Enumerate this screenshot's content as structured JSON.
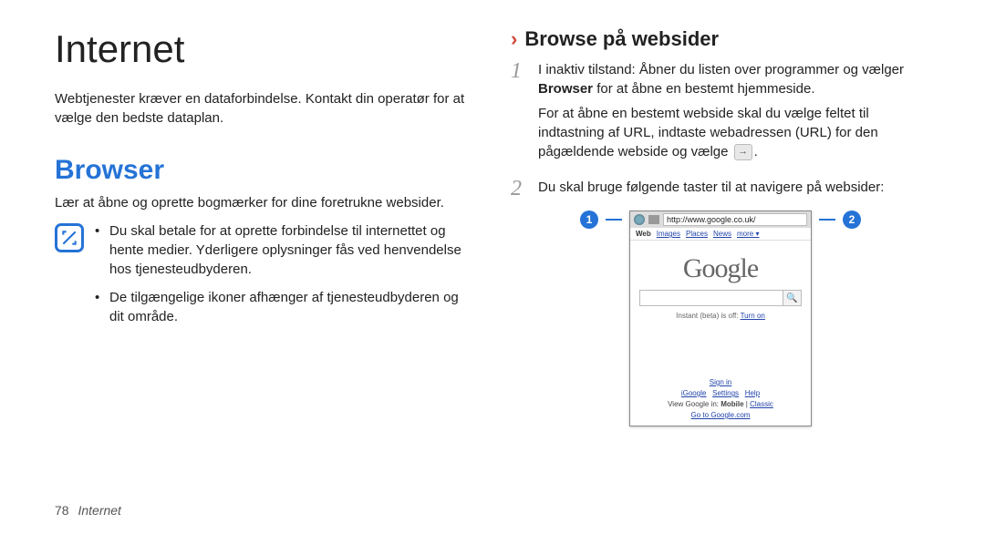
{
  "left": {
    "title": "Internet",
    "intro": "Webtjenester kræver en dataforbindelse. Kontakt din operatør for at vælge den bedste dataplan.",
    "section_title": "Browser",
    "section_desc": "Lær at åbne og oprette bogmærker for dine foretrukne websider.",
    "bullets": [
      "Du skal betale for at oprette forbindelse til internettet og hente medier. Yderligere oplysninger fås ved henvendelse hos tjenesteudbyderen.",
      "De tilgængelige ikoner afhænger af tjenesteudbyderen og dit område."
    ]
  },
  "right": {
    "subsection_title": "Browse på websider",
    "step1_a": "I inaktiv tilstand: Åbner du listen over programmer og vælger ",
    "step1_bold": "Browser",
    "step1_b": " for at åbne en bestemt hjemmeside.",
    "step1_p2": "For at åbne en bestemt webside skal du vælge feltet til indtastning af URL, indtaste webadressen (URL) for den pågældende webside og vælge ",
    "step1_p2_end": ".",
    "step2": "Du skal bruge følgende taster til at navigere på websider:",
    "callout_left": "1",
    "callout_right": "2",
    "phone": {
      "url": "http://www.google.co.uk/",
      "tabs": [
        "Web",
        "Images",
        "Places",
        "News",
        "more ▾"
      ],
      "logo": "Google",
      "instant_prefix": "Instant (beta) is off: ",
      "instant_link": "Turn on",
      "signin": "Sign in",
      "footer_links": [
        "iGoogle",
        "Settings",
        "Help"
      ],
      "view_prefix": "View Google in: ",
      "view_bold": "Mobile",
      "view_sep": " | ",
      "view_link": "Classic",
      "goto": "Go to Google.com"
    }
  },
  "footer": {
    "page": "78",
    "section": "Internet"
  }
}
